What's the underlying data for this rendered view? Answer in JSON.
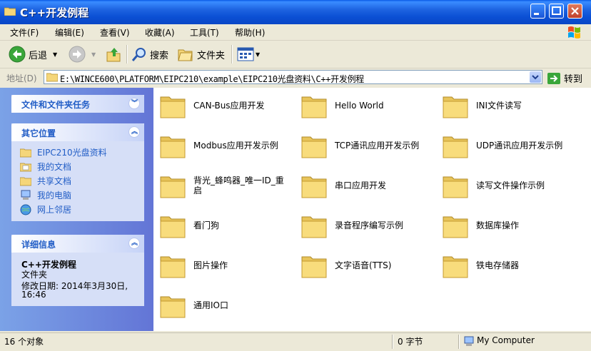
{
  "window": {
    "title": "C++开发例程"
  },
  "menu": [
    "文件(F)",
    "编辑(E)",
    "查看(V)",
    "收藏(A)",
    "工具(T)",
    "帮助(H)"
  ],
  "toolbar": {
    "back": "后退",
    "search": "搜索",
    "folders": "文件夹"
  },
  "address": {
    "label": "地址(D)",
    "path": "E:\\WINCE600\\PLATFORM\\EIPC210\\example\\EIPC210光盘资料\\C++开发例程",
    "go": "转到"
  },
  "sidebar": {
    "tasks_title": "文件和文件夹任务",
    "other_title": "其它位置",
    "other_links": [
      "EIPC210光盘资料",
      "我的文档",
      "共享文档",
      "我的电脑",
      "网上邻居"
    ],
    "details_title": "详细信息",
    "details_name": "C++开发例程",
    "details_type": "文件夹",
    "details_modified": "修改日期: 2014年3月30日,",
    "details_time": "16:46"
  },
  "folders": [
    "CAN-Bus应用开发",
    "Hello World",
    "INI文件读写",
    "Modbus应用开发示例",
    "TCP通讯应用开发示例",
    "UDP通讯应用开发示例",
    "背光_蜂鸣器_唯一ID_重启",
    "串口应用开发",
    "读写文件操作示例",
    "看门狗",
    "录音程序编写示例",
    "数据库操作",
    "图片操作",
    "文字语音(TTS)",
    "铁电存储器",
    "通用IO口"
  ],
  "status": {
    "objects": "16 个对象",
    "size": "0 字节",
    "location": "My Computer"
  }
}
